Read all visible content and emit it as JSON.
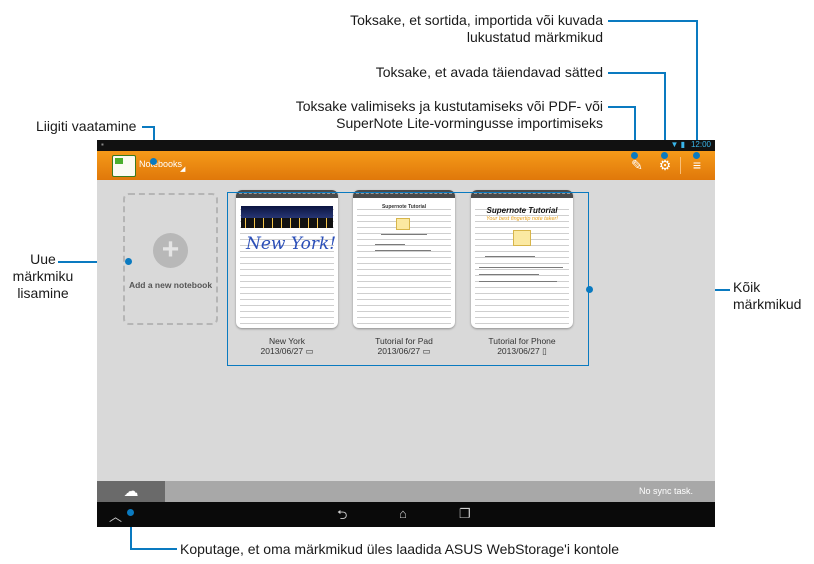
{
  "callouts": {
    "sort": [
      "Toksake, et sortida, importida või kuvada",
      "lukustatud märkmikud"
    ],
    "settings": "Toksake, et avada täiendavad sätted",
    "select": [
      "Toksake valimiseks ja kustutamiseks või PDF- või",
      "SuperNote Lite-vormingusse importimiseks"
    ],
    "view": "Liigiti vaatamine",
    "add": [
      "Uue",
      "märkmiku",
      "lisamine"
    ],
    "all": [
      "Kõik",
      "märkmikud"
    ],
    "upload": "Koputage, et oma märkmikud üles laadida ASUS WebStorage'i kontole"
  },
  "statusbar": {
    "time": "12:00"
  },
  "actionbar": {
    "title": "Notebooks"
  },
  "add_notebook": {
    "label": "Add a new notebook"
  },
  "notebooks": [
    {
      "title": "New York",
      "date": "2013/06/27",
      "device": "pad",
      "cover_text": "New York!"
    },
    {
      "title": "Tutorial for Pad",
      "date": "2013/06/27",
      "device": "pad",
      "cover_text": "Supernote Tutorial"
    },
    {
      "title": "Tutorial for Phone",
      "date": "2013/06/27",
      "device": "phone",
      "cover_text": "Supernote Tutorial",
      "cover_sub": "Your best fingertip note taker!"
    }
  ],
  "sync": {
    "status": "No sync task."
  },
  "colors": {
    "accent": "#0a7ac0",
    "actionbar": "#f08c12"
  }
}
